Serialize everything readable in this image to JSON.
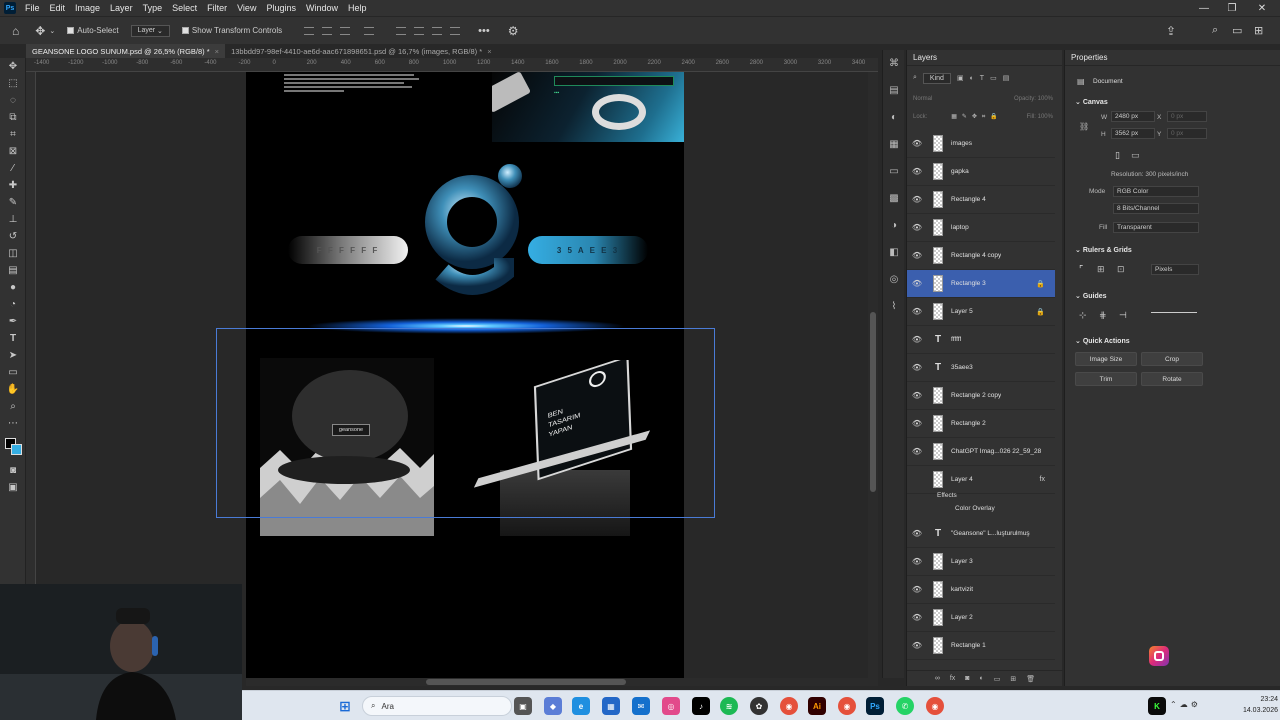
{
  "app": {
    "logo": "Ps"
  },
  "menu": [
    "File",
    "Edit",
    "Image",
    "Layer",
    "Type",
    "Select",
    "Filter",
    "View",
    "Plugins",
    "Window",
    "Help"
  ],
  "options": {
    "auto_select": "Auto-Select",
    "target": "Layer",
    "transform": "Show Transform Controls",
    "more": "•••"
  },
  "tabs": [
    {
      "label": "GEANSONE LOGO SUNUM.psd @ 26,5% (RGB/8) *",
      "close": "×"
    },
    {
      "label": "13bbdd97-98ef-4410-ae6d-aac671898651.psd @ 16,7% (images, RGB/8) *",
      "close": "×"
    }
  ],
  "ruler_ticks": [
    "-1400",
    "-1300",
    "-1200",
    "-1100",
    "-1000",
    "-900",
    "-800",
    "-700",
    "-600",
    "-500",
    "-400",
    "-300",
    "-200",
    "-100",
    "0",
    "100",
    "200",
    "300",
    "400",
    "500",
    "600",
    "700",
    "800",
    "900",
    "1000",
    "1100",
    "1200",
    "1300",
    "1400",
    "1500",
    "1600",
    "1700",
    "1800",
    "1900",
    "2000",
    "2100",
    "2200",
    "2300",
    "2400",
    "2500",
    "2600",
    "2700",
    "2800",
    "2900",
    "3000",
    "3100",
    "3200",
    "3300",
    "3400",
    "3500"
  ],
  "artboard": {
    "pill_left": "F F F F F F",
    "pill_right": "3 5 A E E 3",
    "cap_label": "geansone",
    "laptop_text": [
      "BEN",
      "TASARIM",
      "YAPAN"
    ]
  },
  "layers_panel": {
    "title": "Layers",
    "kind_label": "Kind",
    "mode": "Normal",
    "opacity_label": "Opacity:",
    "opacity": "100%",
    "lock_label": "Lock:",
    "fill_label": "Fill:",
    "fill": "100%",
    "layers": [
      {
        "name": "images",
        "kind": "smart",
        "visible": true
      },
      {
        "name": "gapka",
        "kind": "smart",
        "visible": true
      },
      {
        "name": "Rectangle 4",
        "kind": "raster",
        "visible": true
      },
      {
        "name": "laptop",
        "kind": "smart",
        "visible": true
      },
      {
        "name": "Rectangle 4 copy",
        "kind": "raster",
        "visible": true
      },
      {
        "name": "Rectangle 3",
        "kind": "raster",
        "visible": true,
        "selected": true,
        "locked": true
      },
      {
        "name": "Layer 5",
        "kind": "raster",
        "visible": true,
        "locked": true
      },
      {
        "name": "ffffff",
        "kind": "text",
        "visible": true
      },
      {
        "name": "35aee3",
        "kind": "text",
        "visible": true
      },
      {
        "name": "Rectangle 2 copy",
        "kind": "raster",
        "visible": true
      },
      {
        "name": "Rectangle 2",
        "kind": "raster",
        "visible": true
      },
      {
        "name": "ChatGPT Imag...026 22_59_28",
        "kind": "raster",
        "visible": true
      },
      {
        "name": "Layer 4",
        "kind": "raster",
        "visible": false,
        "fx": "fx"
      }
    ],
    "effects_label": "Effects",
    "effect_item": "Color Overlay",
    "layers_after": [
      {
        "name": "\"Geansone\" L...luşturulmuş",
        "kind": "text",
        "visible": true
      },
      {
        "name": "Layer 3",
        "kind": "raster",
        "visible": true
      },
      {
        "name": "kartvizit",
        "kind": "smart",
        "visible": true
      },
      {
        "name": "Layer 2",
        "kind": "raster",
        "visible": true
      },
      {
        "name": "Rectangle 1",
        "kind": "raster",
        "visible": true
      }
    ]
  },
  "properties": {
    "title": "Properties",
    "doc_label": "Document",
    "canvas_label": "Canvas",
    "w_label": "W",
    "w": "2480 px",
    "h_label": "H",
    "h": "3562 px",
    "x_label": "X",
    "x_val": "0 px",
    "y_label": "Y",
    "y_val": "0 px",
    "resolution": "Resolution: 300 pixels/inch",
    "mode_label": "Mode",
    "mode": "RGB Color",
    "depth": "8 Bits/Channel",
    "fill_label": "Fill",
    "fill": "Transparent",
    "rulers_label": "Rulers & Grids",
    "units": "Pixels",
    "guides_label": "Guides",
    "quick_label": "Quick Actions",
    "btn_image_size": "Image Size",
    "btn_crop": "Crop",
    "btn_trim": "Trim",
    "btn_rotate": "Rotate"
  },
  "taskbar": {
    "search": "Ara",
    "time": "23:24",
    "date": "14.03.2026"
  },
  "colors": {
    "accent": "#3b5fae",
    "selection": "#4a7bd6",
    "blue_pill": "#35aee3"
  }
}
